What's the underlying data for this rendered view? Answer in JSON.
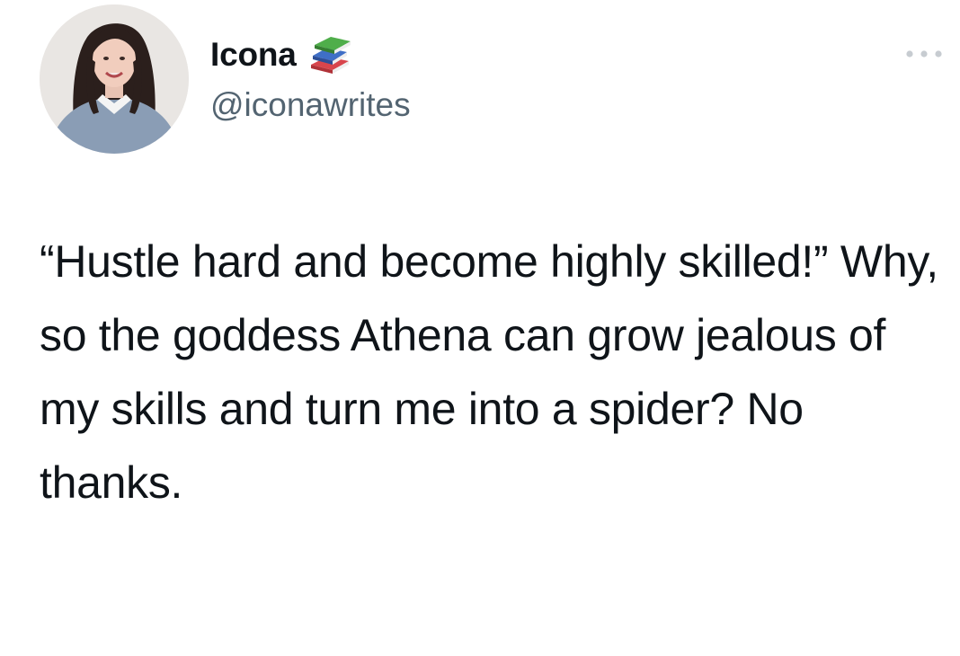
{
  "author": {
    "display_name": "Icona",
    "badge_icon": "books-icon",
    "handle": "@iconawrites"
  },
  "menu": {
    "more_icon": "more-horizontal-icon"
  },
  "tweet": {
    "text": "“Hustle hard and become highly skilled!” Why, so the goddess Athena can grow jealous of my skills and turn me into a spider? No thanks."
  },
  "colors": {
    "text": "#0f1419",
    "secondary_text": "#536471",
    "background": "#ffffff"
  }
}
